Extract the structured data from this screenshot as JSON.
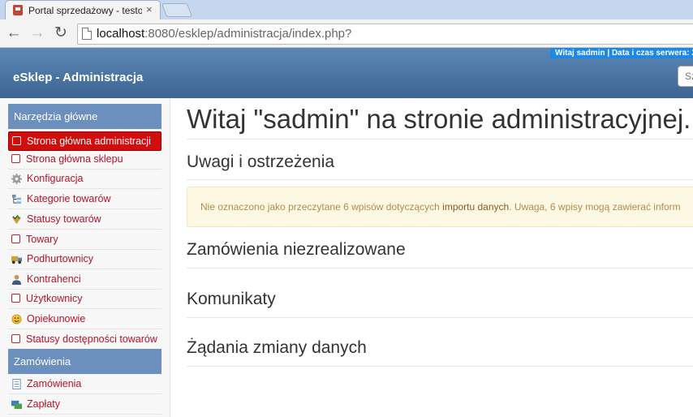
{
  "browser": {
    "tab_title": "Portal sprzedażowy - testo",
    "tab_close": "×",
    "back": "←",
    "forward": "→",
    "reload": "↻",
    "url_host": "localhost",
    "url_rest": ":8080/esklep/administracja/index.php?"
  },
  "header": {
    "info": "Witaj  sadmin  | Data i czas serwera: 2",
    "app_title": "eSklep - Administracja",
    "search_placeholder": "Sz"
  },
  "sidebar": {
    "sections": [
      {
        "title": "Narzędzia główne",
        "items": [
          {
            "label": "Strona główna administracji",
            "icon": "checkbox-icon",
            "active": true
          },
          {
            "label": "Strona główna sklepu",
            "icon": "checkbox-icon"
          },
          {
            "label": "Konfiguracja",
            "icon": "gear-icon"
          },
          {
            "label": "Kategorie towarów",
            "icon": "category-tree-icon"
          },
          {
            "label": "Statusy towarów",
            "icon": "status-icon"
          },
          {
            "label": "Towary",
            "icon": "checkbox-icon"
          },
          {
            "label": "Podhurtownicy",
            "icon": "truck-icon"
          },
          {
            "label": "Kontrahenci",
            "icon": "person-icon"
          },
          {
            "label": "Użytkownicy",
            "icon": "checkbox-icon"
          },
          {
            "label": "Opiekunowie",
            "icon": "smiley-icon"
          },
          {
            "label": "Statusy dostępności towarów",
            "icon": "checkbox-icon"
          }
        ]
      },
      {
        "title": "Zamówienia",
        "items": [
          {
            "label": "Zamówienia",
            "icon": "document-icon"
          },
          {
            "label": "Zapłaty",
            "icon": "payment-icon"
          }
        ]
      }
    ]
  },
  "main": {
    "title": "Witaj \"sadmin\" na stronie administracyjnej.",
    "warnings_title": "Uwagi i ostrzeżenia",
    "alert_before": "Nie oznaczono jako przeczytane 6 wpisów dotyczących ",
    "alert_link": "importu danych",
    "alert_after": ". Uwaga, 6 wpisy mogą zawierać inform",
    "orders_title": "Zamówienia niezrealizowane",
    "messages_title": "Komunikaty",
    "requests_title": "Żądania zmiany danych"
  },
  "colors": {
    "header_top": "#5d87b6",
    "header_bottom": "#3c6593",
    "section_head": "#6b90bd",
    "active_item": "#d10d0d",
    "link": "#b1142b",
    "alert_bg": "#fcf8e3"
  }
}
